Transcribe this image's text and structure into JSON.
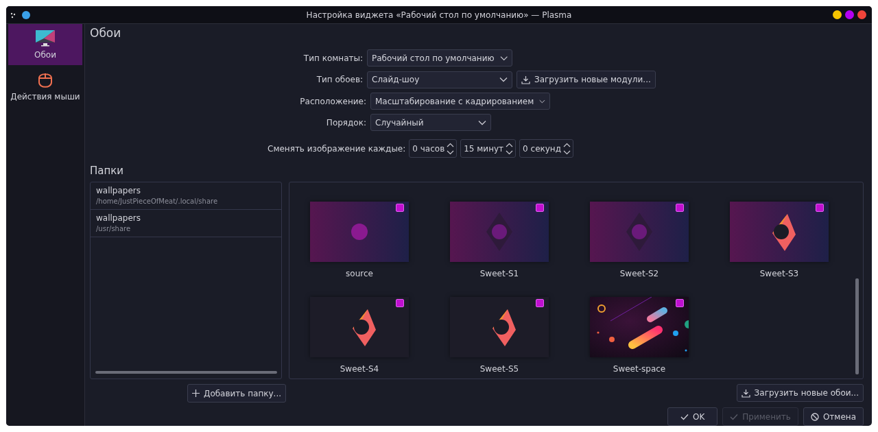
{
  "window": {
    "title": "Настройка виджета «Рабочий стол по умолчанию» — Plasma"
  },
  "sidebar": {
    "items": [
      {
        "kind": "monitor",
        "label": "Обои",
        "selected": true
      },
      {
        "kind": "mouse",
        "label": "Действия мыши",
        "selected": false
      }
    ]
  },
  "page_title": "Обои",
  "form": {
    "rows": [
      {
        "label": "Тип комнаты:",
        "value": "Рабочий стол по умолчанию",
        "kind": "wide"
      },
      {
        "label": "Тип обоев:",
        "value": "Слайд-шоу",
        "kind": "wide",
        "button": "Загрузить новые модули..."
      },
      {
        "label": "Расположение:",
        "value": "Масштабирование с кадрированием",
        "kind": "wide"
      },
      {
        "label": "Порядок:",
        "value": "Случайный",
        "kind": "narrow"
      }
    ],
    "interval": {
      "label": "Сменять изображение каждые:",
      "spinners": [
        "0 часов",
        "15 минут",
        "0 секунд"
      ]
    }
  },
  "folders_title": "Папки",
  "folders": [
    {
      "name": "wallpapers",
      "path": "/home/JustPieceOfMeat/.local/share"
    },
    {
      "name": "wallpapers",
      "path": "/usr/share"
    }
  ],
  "wallpapers": [
    {
      "name": "source",
      "kind": "dim-circle",
      "checked": true
    },
    {
      "name": "Sweet-S1",
      "kind": "dim-diamond",
      "checked": true
    },
    {
      "name": "Sweet-S2",
      "kind": "dim-diamond",
      "checked": true
    },
    {
      "name": "Sweet-S3",
      "kind": "orange",
      "checked": true
    },
    {
      "name": "Sweet-S4",
      "kind": "orange-dark",
      "checked": true
    },
    {
      "name": "Sweet-S5",
      "kind": "orange-dark",
      "checked": true
    },
    {
      "name": "Sweet-space",
      "kind": "space",
      "checked": true
    }
  ],
  "add_folder_button": "Добавить папку...",
  "get_wallpapers_button": "Загрузить новые обои...",
  "buttons": [
    {
      "kind": "ok",
      "label": "OK",
      "disabled": false
    },
    {
      "kind": "apply",
      "label": "Применить",
      "disabled": true
    },
    {
      "kind": "cancel",
      "label": "Отмена",
      "disabled": false
    }
  ]
}
